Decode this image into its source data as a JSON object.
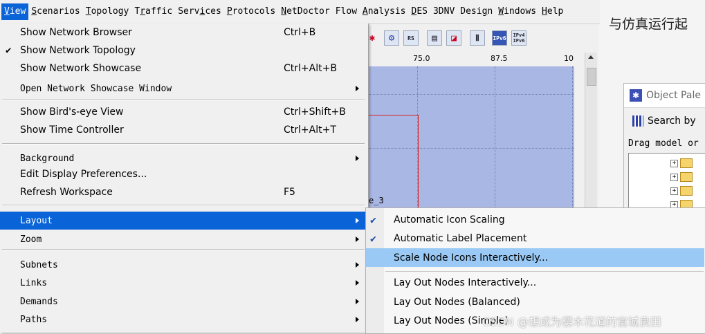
{
  "menubar": {
    "items": [
      {
        "pre": "",
        "key": "V",
        "post": "iew"
      },
      {
        "pre": "",
        "key": "S",
        "post": "cenarios"
      },
      {
        "pre": "",
        "key": "T",
        "post": "opology"
      },
      {
        "pre": "T",
        "key": "r",
        "post": "affic"
      },
      {
        "pre": "Serv",
        "key": "i",
        "post": "ces"
      },
      {
        "pre": "",
        "key": "P",
        "post": "rotocols"
      },
      {
        "pre": "",
        "key": "N",
        "post": "etDoctor"
      },
      {
        "pre": "Flow ",
        "key": "A",
        "post": "nalysis"
      },
      {
        "pre": "",
        "key": "D",
        "post": "ES"
      },
      {
        "pre": "3DNV",
        "key": "",
        "post": ""
      },
      {
        "pre": "Desi",
        "key": "g",
        "post": "n"
      },
      {
        "pre": "",
        "key": "W",
        "post": "indows"
      },
      {
        "pre": "",
        "key": "H",
        "post": "elp"
      }
    ]
  },
  "view_menu": {
    "show_network_browser": {
      "label": "Show Network Browser",
      "shortcut": "Ctrl+B"
    },
    "show_network_topology": {
      "label": "Show Network Topology",
      "checked": true,
      "check_glyph": "✔"
    },
    "show_network_showcase": {
      "label": "Show Network Showcase",
      "shortcut": "Ctrl+Alt+B"
    },
    "open_network_showcase_window": {
      "label": "Open Network Showcase Window"
    },
    "show_birds_eye_view": {
      "label": "Show Bird's-eye View",
      "shortcut": "Ctrl+Shift+B"
    },
    "show_time_controller": {
      "label": "Show Time Controller",
      "shortcut": "Ctrl+Alt+T"
    },
    "background": {
      "label": "Background"
    },
    "edit_display_preferences": {
      "label": "Edit Display Preferences..."
    },
    "refresh_workspace": {
      "label": "Refresh Workspace",
      "shortcut": "F5"
    },
    "layout": {
      "label": "Layout"
    },
    "zoom": {
      "label": "Zoom"
    },
    "subnets": {
      "label": "Subnets"
    },
    "links": {
      "label": "Links"
    },
    "demands": {
      "label": "Demands"
    },
    "paths": {
      "label": "Paths"
    }
  },
  "layout_menu": {
    "automatic_icon_scaling": {
      "label": "Automatic Icon Scaling",
      "checked": true,
      "check_glyph": "✔"
    },
    "automatic_label_placement": {
      "label": "Automatic Label Placement",
      "checked": true,
      "check_glyph": "✔"
    },
    "scale_node_icons_interactively": {
      "label": "Scale Node Icons Interactively..."
    },
    "lay_out_nodes_interactively": {
      "label": "Lay Out Nodes Interactively..."
    },
    "lay_out_nodes_balanced": {
      "label": "Lay Out Nodes (Balanced)"
    },
    "lay_out_nodes_simple": {
      "label": "Lay Out Nodes (Simple)"
    }
  },
  "toolbar": {
    "icons": [
      "node-icon",
      "gear-icon",
      "rs-icon",
      "chart-icon",
      "graph-icon",
      "info-icon",
      "ipv6-icon",
      "ipv4-ipv6-icon"
    ],
    "ipv6_label": "IPv6",
    "ipv4_label": "IPv4",
    "rs_label": "RS"
  },
  "ruler": {
    "ticks": [
      "75.0",
      "87.5",
      "10"
    ]
  },
  "workspace": {
    "background_color": "#a9b7e4",
    "node_label": "e_3"
  },
  "doc": {
    "text": "与仿真运行起"
  },
  "palette": {
    "title": "Object Pale",
    "search_label": "Search by",
    "drag_hint": "Drag model or s"
  },
  "watermark": "CSDN @想成为樱木花道的宫城良田",
  "colors": {
    "menu_highlight": "#0a64d8",
    "submenu_highlight": "#99c9f4"
  }
}
